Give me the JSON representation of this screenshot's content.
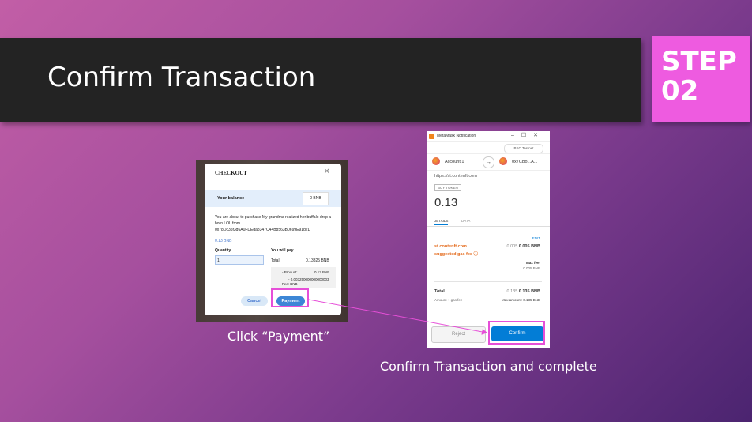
{
  "slide": {
    "title": "Confirm Transaction",
    "step_label_1": "STEP",
    "step_label_2": "02",
    "caption_left": "Click “Payment”",
    "caption_right": "Confirm Transaction and complete"
  },
  "checkout": {
    "title": "CHECKOUT",
    "close": "✕",
    "balance_label": "Your balance",
    "balance_value": "0 BNB",
    "description": "You are about to purchase My grandma realized her buffalo drop a horn LOL from 0x78Dc35f3d6A0FDEda8347C44B8563B0699E91d2D",
    "price": "0.13 BNB",
    "quantity_label": "Quantity",
    "quantity_value": "1",
    "you_will_pay_label": "You will pay",
    "total_label": "Total",
    "total_value": "0.13325 BNB",
    "product_label": "- Product:",
    "product_value": "0.13 BNB",
    "fee_value": "- 0.003250000000000003",
    "fee_label": "Fee: BNB",
    "cancel_label": "Cancel",
    "payment_label": "Payment"
  },
  "metamask": {
    "window_title": "MetaMask Notification",
    "window_controls": "–☐✕",
    "network": "BSC Testnet",
    "account_from": "Account 1",
    "account_to": "0x7CBo...A...",
    "arrow": "→",
    "origin": "https://st.contenft.com",
    "action_badge": "BUY TOKEN",
    "amount": "0.13",
    "tab_details": "DETAILS",
    "tab_data": "DATA",
    "edit_label": "EDIT",
    "site": "st.contenft.com",
    "suggested_fee": "suggested gas fee ⓘ",
    "fee_grey": "0.005",
    "fee_bold": "0.005 BNB",
    "max_fee_label": "Max fee:",
    "max_fee_value": "0.005 BNB",
    "total_label": "Total",
    "total_grey": "0.135",
    "total_bold": "0.135 BNB",
    "amount_gas_label": "Amount + gas fee",
    "max_amount": "Max amount: 0.135 BNB",
    "reject_label": "Reject",
    "confirm_label": "Confirm"
  },
  "colors": {
    "highlight": "#e64fd8",
    "step_bg": "#ee5be0",
    "title_bar": "#232323",
    "metamask_blue": "#037dd6"
  }
}
